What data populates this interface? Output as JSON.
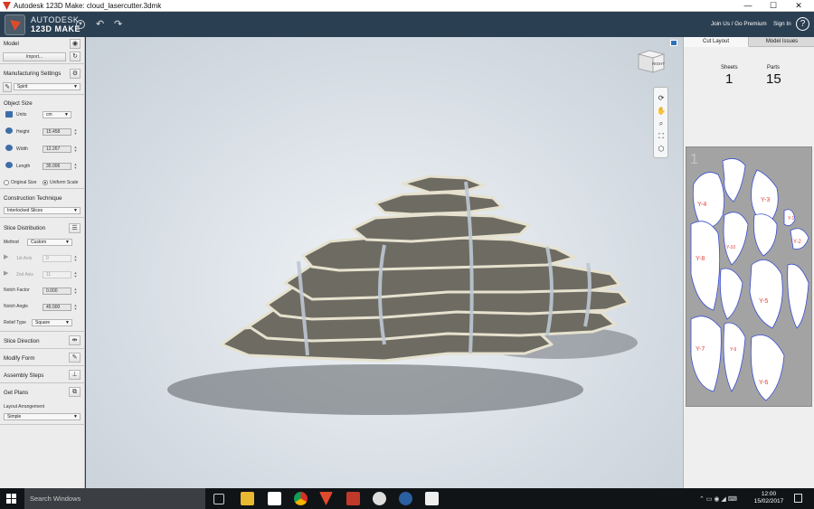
{
  "window": {
    "title": "Autodesk 123D Make: cloud_lasercutter.3dmk",
    "minimize": "—",
    "maximize": "☐",
    "close": "✕"
  },
  "appbar": {
    "brand_line1": "AUTODESK",
    "brand_line2": "123D MAKE",
    "undo_icon": "undo-icon",
    "redo_icon": "redo-icon",
    "join_label": "Join Us / Go Premium",
    "signin_label": "Sign In",
    "help_label": "?"
  },
  "sidebar": {
    "model": {
      "label": "Model",
      "import_label": "Import..."
    },
    "manufacturing": {
      "label": "Manufacturing Settings",
      "selected": "Spirit"
    },
    "object_size": {
      "label": "Object Size",
      "units_label": "Units",
      "units_value": "cm",
      "height_label": "Height",
      "height_value": "15.458",
      "width_label": "Width",
      "width_value": "12.267",
      "length_label": "Length",
      "length_value": "35.006",
      "original_size_label": "Original Size",
      "uniform_scale_label": "Uniform Scale"
    },
    "construction": {
      "label": "Construction Technique",
      "value": "Interlocked Slices"
    },
    "slice_distribution": {
      "label": "Slice Distribution",
      "method_label": "Method",
      "method_value": "Custom",
      "axis1_label": "1st Axis",
      "axis1_value": "0",
      "axis2_label": "2nd Axis",
      "axis2_value": "11",
      "notch_factor_label": "Notch Factor",
      "notch_factor_value": "0.000",
      "notch_angle_label": "Notch Angle",
      "notch_angle_value": "45.000",
      "relief_label": "Relief Type",
      "relief_value": "Square"
    },
    "slice_direction_label": "Slice Direction",
    "modify_form_label": "Modify Form",
    "assembly_label": "Assembly Steps",
    "get_plans": {
      "label": "Get Plans",
      "layout_label": "Layout Arrangement",
      "layout_value": "Simple"
    }
  },
  "viewport": {
    "viewcube_label": "RIGHT"
  },
  "right_panel": {
    "tab_cut": "Cut Layout",
    "tab_issues": "Model Issues",
    "sheets_label": "Sheets",
    "sheets_value": "1",
    "parts_label": "Parts",
    "parts_value": "15",
    "sheet_number": "1",
    "part_labels": [
      "Y-4",
      "Y-3",
      "Y-1",
      "Y-2",
      "Y-10",
      "Y-8",
      "Y-5",
      "Y-7",
      "Y-9",
      "Y-6"
    ]
  },
  "taskbar": {
    "search_text": "Search Windows",
    "time": "12:00",
    "date": "15/02/2017"
  },
  "colors": {
    "appbar": "#2b3f52",
    "viewport": "#dfe4ea",
    "accent": "#2f73b8",
    "slice_line": "#3a4ed0"
  }
}
